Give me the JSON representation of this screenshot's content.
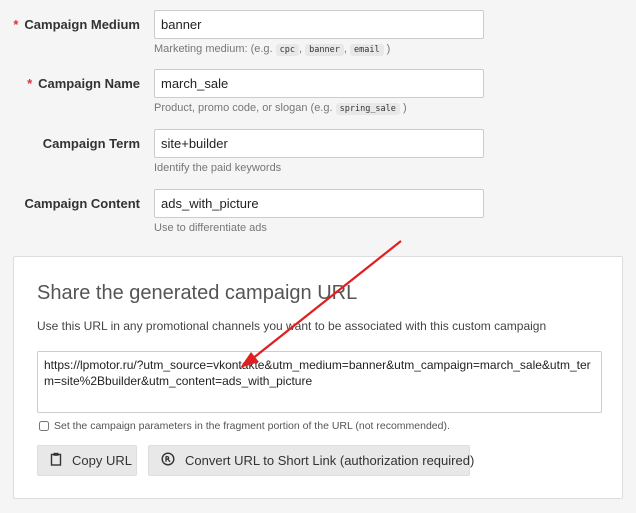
{
  "fields": {
    "medium": {
      "required_mark": "*",
      "label": "Campaign Medium",
      "value": "banner",
      "help_prefix": "Marketing medium: (e.g. ",
      "help_codes": [
        "cpc",
        "banner",
        "email"
      ],
      "help_suffix": " )"
    },
    "name": {
      "required_mark": "*",
      "label": "Campaign Name",
      "value": "march_sale",
      "help_prefix": "Product, promo code, or slogan (e.g. ",
      "help_code": "spring_sale",
      "help_suffix": " )"
    },
    "term": {
      "label": "Campaign Term",
      "value": "site+builder",
      "help": "Identify the paid keywords"
    },
    "content": {
      "label": "Campaign Content",
      "value": "ads_with_picture",
      "help": "Use to differentiate ads"
    }
  },
  "share": {
    "title": "Share the generated campaign URL",
    "description": "Use this URL in any promotional channels you want to be associated with this custom campaign",
    "url": "https://lpmotor.ru/?utm_source=vkontakte&utm_medium=banner&utm_campaign=march_sale&utm_term=site%2Bbuilder&utm_content=ads_with_picture",
    "fragment_checkbox_label": "Set the campaign parameters in the fragment portion of the URL (not recommended).",
    "fragment_checked": false,
    "copy_button": "Copy URL",
    "copy_icon": "clipboard-icon",
    "short_link_button": "Convert URL to Short Link (authorization required)",
    "short_link_icon": "link-shortener-icon"
  },
  "annotation": {
    "arrow_color": "#e02020"
  },
  "colors": {
    "required": "#d9333f",
    "panel_bg": "#ffffff",
    "page_bg": "#f5f5f5",
    "button_bg": "#e8e8e8"
  }
}
